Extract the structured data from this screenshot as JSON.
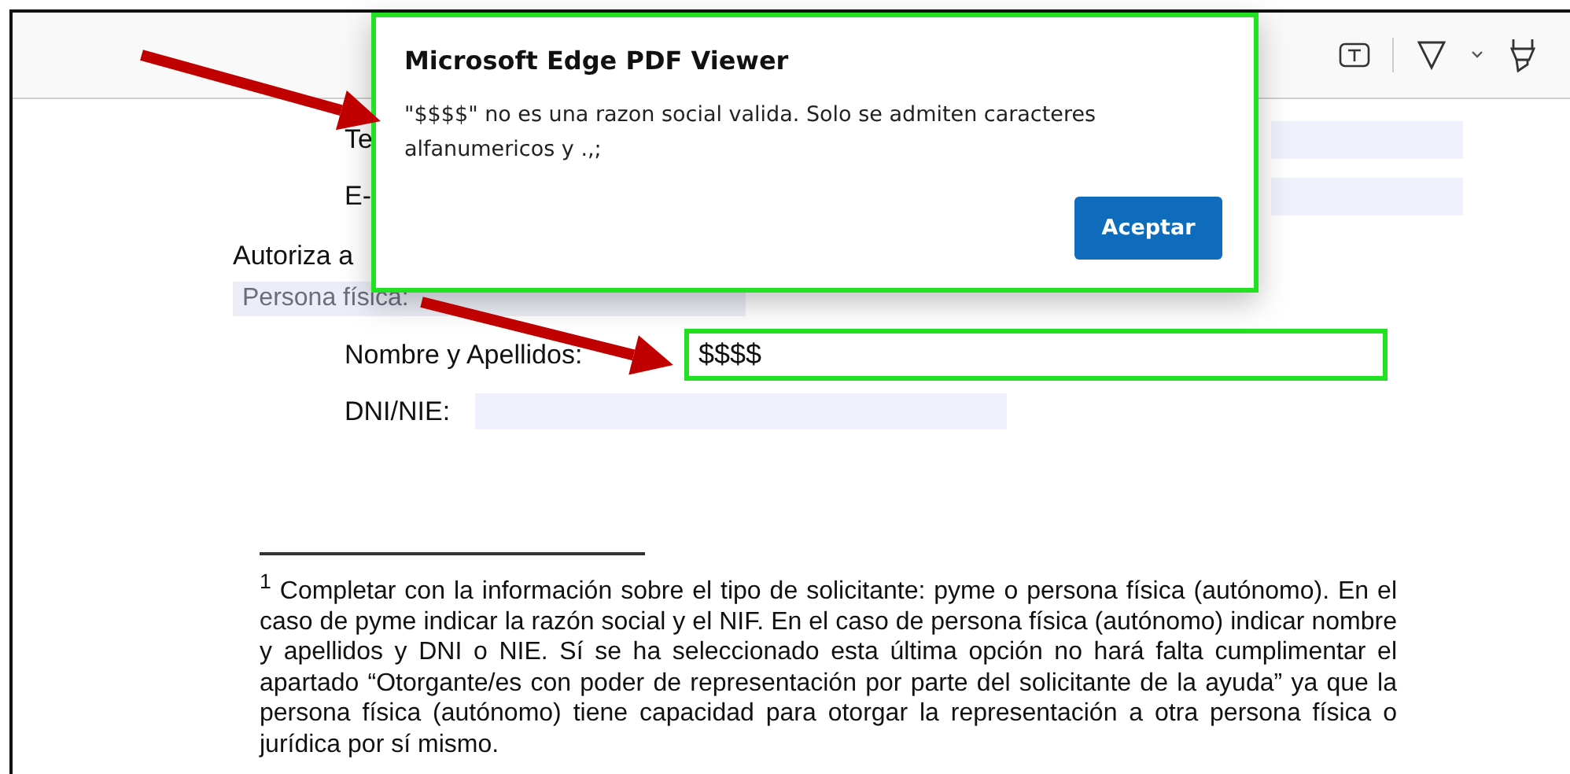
{
  "dialog": {
    "title": "Microsoft Edge PDF Viewer",
    "message": "\"$$$$\" no es una razon social valida. Solo se admiten caracteres alfanumericos y .,;",
    "button": "Aceptar"
  },
  "document": {
    "contact_rows": [
      {
        "label": "Te"
      },
      {
        "label": "E-"
      }
    ],
    "heading": "Autoriza a",
    "section": "Persona física:",
    "fields": [
      {
        "label": "Nombre y Apellidos:",
        "value": "$$$$",
        "highlighted": true
      },
      {
        "label": "DNI/NIE:",
        "highlighted": false
      }
    ],
    "footnote": "$^{1}$ Completar con la información sobre el tipo de solicitante: pyme o persona física (autónomo). En el caso de pyme indicar la razón social y el NIF. En el caso de persona física (autónomo) indicar nombre y apellidos y DNI o NIE. Sí se ha seleccionado esta última opción no hará falta cumplimentar el apartado “Otorgante/es con poder de representación por parte del solicitante de la ayuda” ya que la persona física (autónomo) tiene capacidad para otorgar la representación a otra persona física o jurídica por sí mismo."
  }
}
